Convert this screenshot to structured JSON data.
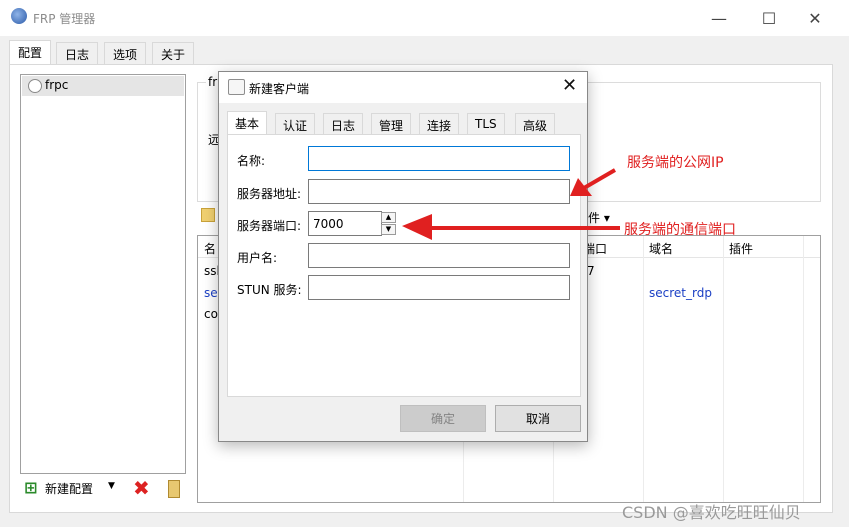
{
  "window": {
    "title": "FRP 管理器",
    "minimize": "—",
    "maximize": "☐",
    "close": "✕"
  },
  "main_tabs": [
    "配置",
    "日志",
    "选项",
    "关于"
  ],
  "config_list": {
    "items": [
      {
        "label": "frpc"
      }
    ]
  },
  "toolbar": {
    "add_label": "新建配置",
    "dropdown": "▼",
    "delete": "✖"
  },
  "background": {
    "info_box_label": "fr",
    "info_box_label2": "远",
    "plugin_menu": "件 ▾",
    "table_headers": [
      "名",
      "端口",
      "域名",
      "插件"
    ],
    "rows": [
      {
        "name": "ssl",
        "port": "7",
        "domain": ""
      },
      {
        "name": "sec",
        "port": "",
        "domain": "secret_rdp"
      },
      {
        "name": "co",
        "port": "",
        "domain": ""
      }
    ]
  },
  "dialog": {
    "title": "新建客户端",
    "close": "✕",
    "tabs": [
      "基本",
      "认证",
      "日志",
      "管理",
      "连接",
      "TLS",
      "高级"
    ],
    "fields": {
      "name_label": "名称:",
      "name_value": "",
      "server_addr_label": "服务器地址:",
      "server_addr_value": "",
      "server_port_label": "服务器端口:",
      "server_port_value": "7000",
      "username_label": "用户名:",
      "username_value": "",
      "stun_label": "STUN 服务:",
      "stun_value": ""
    },
    "buttons": {
      "ok": "确定",
      "cancel": "取消"
    }
  },
  "annotations": {
    "public_ip": "服务端的公网IP",
    "comm_port": "服务端的通信端口"
  },
  "watermark": "CSDN @喜欢吃旺旺仙贝",
  "colors": {
    "annotation_red": "#e02020",
    "accent_blue": "#0078d7",
    "link_blue": "#1a3fc4"
  }
}
